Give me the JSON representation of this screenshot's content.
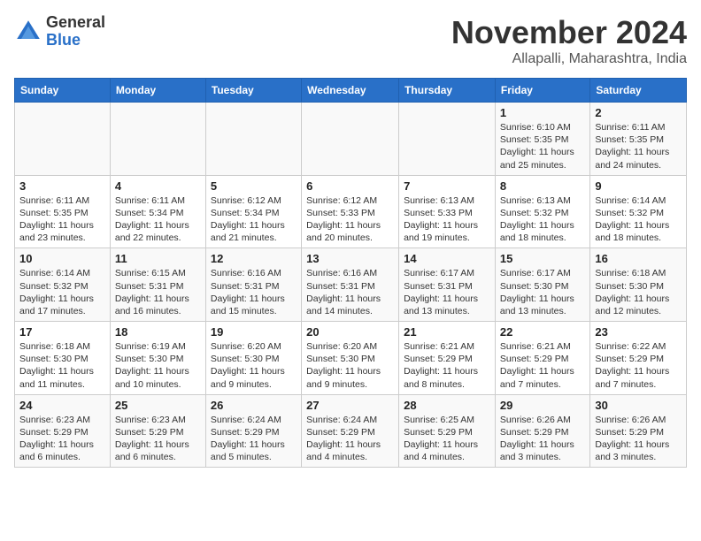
{
  "logo": {
    "general": "General",
    "blue": "Blue"
  },
  "title": "November 2024",
  "subtitle": "Allapalli, Maharashtra, India",
  "days_of_week": [
    "Sunday",
    "Monday",
    "Tuesday",
    "Wednesday",
    "Thursday",
    "Friday",
    "Saturday"
  ],
  "weeks": [
    [
      {
        "day": "",
        "info": ""
      },
      {
        "day": "",
        "info": ""
      },
      {
        "day": "",
        "info": ""
      },
      {
        "day": "",
        "info": ""
      },
      {
        "day": "",
        "info": ""
      },
      {
        "day": "1",
        "info": "Sunrise: 6:10 AM\nSunset: 5:35 PM\nDaylight: 11 hours and 25 minutes."
      },
      {
        "day": "2",
        "info": "Sunrise: 6:11 AM\nSunset: 5:35 PM\nDaylight: 11 hours and 24 minutes."
      }
    ],
    [
      {
        "day": "3",
        "info": "Sunrise: 6:11 AM\nSunset: 5:35 PM\nDaylight: 11 hours and 23 minutes."
      },
      {
        "day": "4",
        "info": "Sunrise: 6:11 AM\nSunset: 5:34 PM\nDaylight: 11 hours and 22 minutes."
      },
      {
        "day": "5",
        "info": "Sunrise: 6:12 AM\nSunset: 5:34 PM\nDaylight: 11 hours and 21 minutes."
      },
      {
        "day": "6",
        "info": "Sunrise: 6:12 AM\nSunset: 5:33 PM\nDaylight: 11 hours and 20 minutes."
      },
      {
        "day": "7",
        "info": "Sunrise: 6:13 AM\nSunset: 5:33 PM\nDaylight: 11 hours and 19 minutes."
      },
      {
        "day": "8",
        "info": "Sunrise: 6:13 AM\nSunset: 5:32 PM\nDaylight: 11 hours and 18 minutes."
      },
      {
        "day": "9",
        "info": "Sunrise: 6:14 AM\nSunset: 5:32 PM\nDaylight: 11 hours and 18 minutes."
      }
    ],
    [
      {
        "day": "10",
        "info": "Sunrise: 6:14 AM\nSunset: 5:32 PM\nDaylight: 11 hours and 17 minutes."
      },
      {
        "day": "11",
        "info": "Sunrise: 6:15 AM\nSunset: 5:31 PM\nDaylight: 11 hours and 16 minutes."
      },
      {
        "day": "12",
        "info": "Sunrise: 6:16 AM\nSunset: 5:31 PM\nDaylight: 11 hours and 15 minutes."
      },
      {
        "day": "13",
        "info": "Sunrise: 6:16 AM\nSunset: 5:31 PM\nDaylight: 11 hours and 14 minutes."
      },
      {
        "day": "14",
        "info": "Sunrise: 6:17 AM\nSunset: 5:31 PM\nDaylight: 11 hours and 13 minutes."
      },
      {
        "day": "15",
        "info": "Sunrise: 6:17 AM\nSunset: 5:30 PM\nDaylight: 11 hours and 13 minutes."
      },
      {
        "day": "16",
        "info": "Sunrise: 6:18 AM\nSunset: 5:30 PM\nDaylight: 11 hours and 12 minutes."
      }
    ],
    [
      {
        "day": "17",
        "info": "Sunrise: 6:18 AM\nSunset: 5:30 PM\nDaylight: 11 hours and 11 minutes."
      },
      {
        "day": "18",
        "info": "Sunrise: 6:19 AM\nSunset: 5:30 PM\nDaylight: 11 hours and 10 minutes."
      },
      {
        "day": "19",
        "info": "Sunrise: 6:20 AM\nSunset: 5:30 PM\nDaylight: 11 hours and 9 minutes."
      },
      {
        "day": "20",
        "info": "Sunrise: 6:20 AM\nSunset: 5:30 PM\nDaylight: 11 hours and 9 minutes."
      },
      {
        "day": "21",
        "info": "Sunrise: 6:21 AM\nSunset: 5:29 PM\nDaylight: 11 hours and 8 minutes."
      },
      {
        "day": "22",
        "info": "Sunrise: 6:21 AM\nSunset: 5:29 PM\nDaylight: 11 hours and 7 minutes."
      },
      {
        "day": "23",
        "info": "Sunrise: 6:22 AM\nSunset: 5:29 PM\nDaylight: 11 hours and 7 minutes."
      }
    ],
    [
      {
        "day": "24",
        "info": "Sunrise: 6:23 AM\nSunset: 5:29 PM\nDaylight: 11 hours and 6 minutes."
      },
      {
        "day": "25",
        "info": "Sunrise: 6:23 AM\nSunset: 5:29 PM\nDaylight: 11 hours and 6 minutes."
      },
      {
        "day": "26",
        "info": "Sunrise: 6:24 AM\nSunset: 5:29 PM\nDaylight: 11 hours and 5 minutes."
      },
      {
        "day": "27",
        "info": "Sunrise: 6:24 AM\nSunset: 5:29 PM\nDaylight: 11 hours and 4 minutes."
      },
      {
        "day": "28",
        "info": "Sunrise: 6:25 AM\nSunset: 5:29 PM\nDaylight: 11 hours and 4 minutes."
      },
      {
        "day": "29",
        "info": "Sunrise: 6:26 AM\nSunset: 5:29 PM\nDaylight: 11 hours and 3 minutes."
      },
      {
        "day": "30",
        "info": "Sunrise: 6:26 AM\nSunset: 5:29 PM\nDaylight: 11 hours and 3 minutes."
      }
    ]
  ]
}
